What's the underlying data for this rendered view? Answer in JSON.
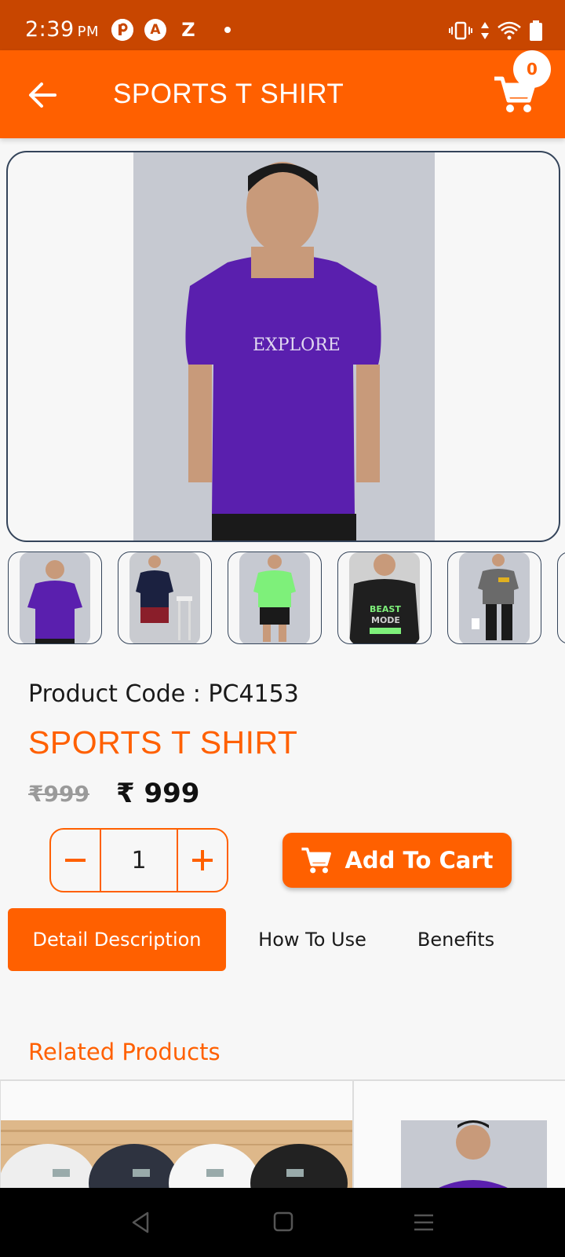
{
  "status_bar": {
    "time": "2:39",
    "ampm": "PM",
    "icons": [
      "app-r-icon",
      "app-a-icon",
      "app-z-icon",
      "dot-icon",
      "vibrate-icon",
      "data-arrows-icon",
      "wifi-icon",
      "battery-icon"
    ],
    "badge_a": "A",
    "badge_z": "Z"
  },
  "header": {
    "title": "SPORTS T SHIRT",
    "cart_count": "0"
  },
  "gallery": {
    "main_shirt_text": "EXPLORE",
    "thumb_4_text_line1": "BEAST",
    "thumb_4_text_line2": "MODE"
  },
  "product": {
    "code_label": "Product Code : PC4153",
    "name": "SPORTS T SHIRT",
    "old_price": "₹999",
    "new_price": "₹ 999",
    "quantity": "1"
  },
  "actions": {
    "add_to_cart": "Add To Cart"
  },
  "tabs": [
    {
      "label": "Detail Description",
      "active": true
    },
    {
      "label": "How To Use",
      "active": false
    },
    {
      "label": "Benefits",
      "active": false
    }
  ],
  "related": {
    "title": "Related Products"
  },
  "colors": {
    "brand": "#ff6000",
    "status_bar": "#c84600",
    "border": "#34445a"
  }
}
